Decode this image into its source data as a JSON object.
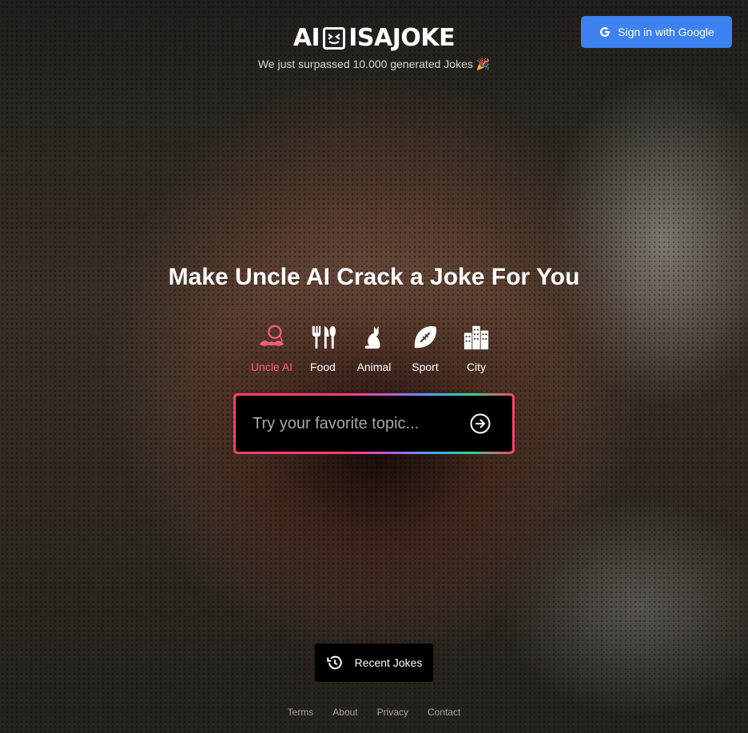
{
  "header": {
    "logo_left": "AI",
    "logo_right": "ISAJOKE",
    "tagline": "We just surpassed 10.000 generated Jokes 🎉",
    "signin_label": "Sign in with Google"
  },
  "hero": {
    "headline": "Make Uncle AI Crack a Joke For You",
    "categories": [
      {
        "label": "Uncle AI",
        "icon": "uncle-ai-icon",
        "active": true
      },
      {
        "label": "Food",
        "icon": "fork-knife-icon",
        "active": false
      },
      {
        "label": "Animal",
        "icon": "cat-icon",
        "active": false
      },
      {
        "label": "Sport",
        "icon": "football-icon",
        "active": false
      },
      {
        "label": "City",
        "icon": "city-buildings-icon",
        "active": false
      }
    ],
    "search": {
      "placeholder": "Try your favorite topic...",
      "value": ""
    }
  },
  "recent": {
    "label": "Recent Jokes",
    "icon": "history-icon"
  },
  "footer": {
    "links": [
      "Terms",
      "About",
      "Privacy",
      "Contact"
    ]
  },
  "colors": {
    "accent_pink": "#ff5a86",
    "signin_blue": "#3d82f0"
  }
}
